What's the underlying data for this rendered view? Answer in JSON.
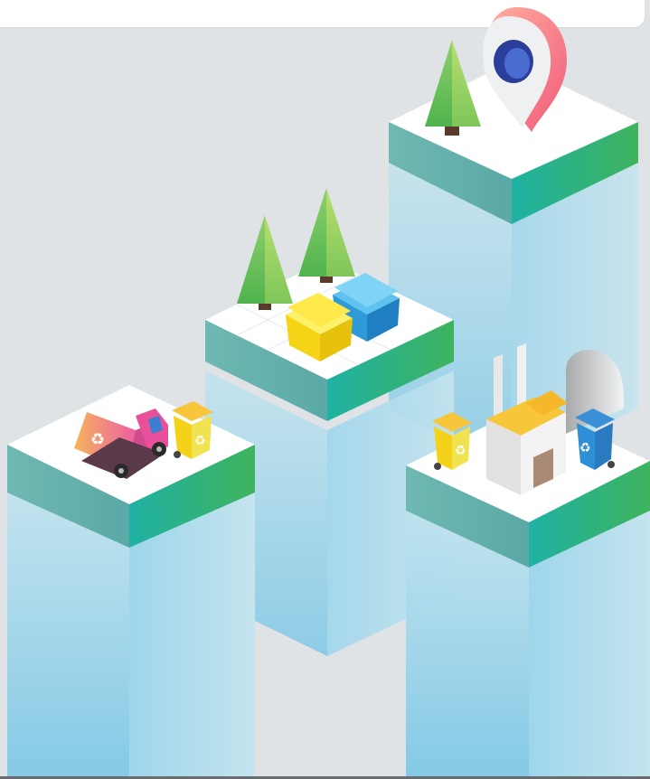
{
  "scene": {
    "title": "",
    "subject": "isometric-recycling-illustration",
    "colors": {
      "background": "#e0e3e6",
      "tile_top": "#ffffff",
      "tile_side_teal": "#3fb39a",
      "tile_side_green": "#2fa86a",
      "column": "#8fd0ea",
      "tree": "#66c05a",
      "bin_yellow": "#f5d21a",
      "bin_blue": "#2f8fd6",
      "pin_red": "#f0607a",
      "truck_pink": "#ea6a9c"
    },
    "icons": [
      "recycle-icon",
      "map-pin-icon",
      "tree-icon",
      "truck-icon",
      "factory-icon"
    ]
  }
}
